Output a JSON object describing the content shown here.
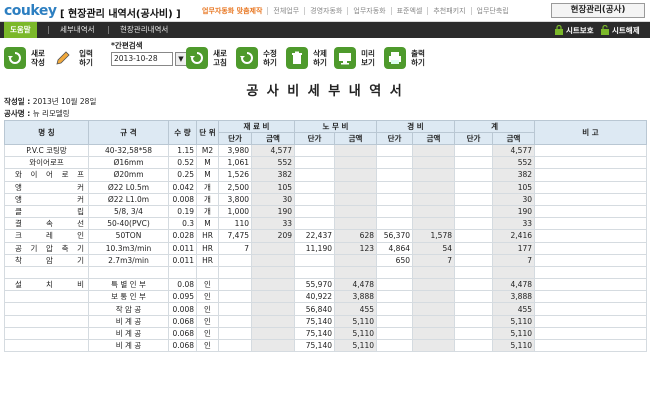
{
  "header": {
    "logo": "coukey",
    "title": "[ 현장관리 내역서(공사비) ]",
    "nav": [
      "업무자동화 맞춤제작",
      "전체업무",
      "경영자동화",
      "업무자동화",
      "표준엑셀",
      "추천패키지",
      "업무단축립"
    ],
    "user_button": "현장관리(공사)"
  },
  "menubar": {
    "tabs": [
      "도움말",
      "세부내역서",
      "현장관리내역서"
    ],
    "sheet_protect": "시트보호",
    "sheet_unprotect": "시트해제"
  },
  "toolbar": {
    "new_label": "새로\n작성",
    "input_label": "입력\n하기",
    "search_caption": "*간편검색",
    "search_date": "2013-10-28",
    "refresh_label": "새로\n고침",
    "edit_label": "수정\n하기",
    "delete_label": "삭제\n하기",
    "preview_label": "미리\n보기",
    "print_label": "출력\n하기"
  },
  "document": {
    "title": "공 사 비   세 부 내 역 서",
    "date_label": "작성일 :",
    "date_value": "2013년 10월 28일",
    "project_label": "공사명 :",
    "project_value": "뉴 리모델링"
  },
  "table": {
    "headers": {
      "name": "명 칭",
      "spec": "규 격",
      "qty": "수 량",
      "unit": "단 위",
      "material": "재 료 비",
      "labor": "노 무 비",
      "expense": "경 비",
      "total": "계",
      "note": "비 고",
      "unit_price": "단가",
      "amount": "금액"
    },
    "rows": [
      [
        "P.V.C 코팅망",
        "40-32,58*58",
        "1.15",
        "M2",
        "3,980",
        "4,577",
        "",
        "",
        "",
        "",
        "",
        "4,577",
        ""
      ],
      [
        "와이어로프",
        "Ø16mm",
        "0.52",
        "M",
        "1,061",
        "552",
        "",
        "",
        "",
        "",
        "",
        "552",
        ""
      ],
      [
        "와 이 어 로 프",
        "Ø20mm",
        "0.25",
        "M",
        "1,526",
        "382",
        "",
        "",
        "",
        "",
        "",
        "382",
        ""
      ],
      [
        "앵 커",
        "Ø22 L0.5m",
        "0.042",
        "개",
        "2,500",
        "105",
        "",
        "",
        "",
        "",
        "",
        "105",
        ""
      ],
      [
        "앵 커",
        "Ø22 L1.0m",
        "0.008",
        "개",
        "3,800",
        "30",
        "",
        "",
        "",
        "",
        "",
        "30",
        ""
      ],
      [
        "클 립",
        "5/8, 3/4",
        "0.19",
        "개",
        "1,000",
        "190",
        "",
        "",
        "",
        "",
        "",
        "190",
        ""
      ],
      [
        "결 속 선",
        "50-40(PVC)",
        "0.3",
        "M",
        "110",
        "33",
        "",
        "",
        "",
        "",
        "",
        "33",
        ""
      ],
      [
        "크 레 인",
        "50TON",
        "0.028",
        "HR",
        "7,475",
        "209",
        "22,437",
        "628",
        "56,370",
        "1,578",
        "",
        "2,416",
        ""
      ],
      [
        "공 기 압 축 기",
        "10.3m3/min",
        "0.011",
        "HR",
        "7",
        "",
        "11,190",
        "123",
        "4,864",
        "54",
        "",
        "177",
        ""
      ],
      [
        "착 암 기",
        "2.7m3/min",
        "0.011",
        "HR",
        "",
        "",
        "",
        "",
        "650",
        "7",
        "",
        "7",
        ""
      ],
      [
        "",
        "",
        "",
        "",
        "",
        "",
        "",
        "",
        "",
        "",
        "",
        "",
        ""
      ],
      [
        "설 치 비",
        "특 별 인 부",
        "0.08",
        "인",
        "",
        "",
        "55,970",
        "4,478",
        "",
        "",
        "",
        "4,478",
        ""
      ],
      [
        "",
        "보 통 인 부",
        "0.095",
        "인",
        "",
        "",
        "40,922",
        "3,888",
        "",
        "",
        "",
        "3,888",
        ""
      ],
      [
        "",
        "작 암 공",
        "0.008",
        "인",
        "",
        "",
        "56,840",
        "455",
        "",
        "",
        "",
        "455",
        ""
      ],
      [
        "",
        "비 계 공",
        "0.068",
        "인",
        "",
        "",
        "75,140",
        "5,110",
        "",
        "",
        "",
        "5,110",
        ""
      ],
      [
        "",
        "비 계 공",
        "0.068",
        "인",
        "",
        "",
        "75,140",
        "5,110",
        "",
        "",
        "",
        "5,110",
        ""
      ],
      [
        "",
        "비 계 공",
        "0.068",
        "인",
        "",
        "",
        "75,140",
        "5,110",
        "",
        "",
        "",
        "5,110",
        ""
      ]
    ]
  },
  "colors": {
    "logo": "#2d7fc1",
    "nav_highlight": "#e87722",
    "menubar_bg": "#2b2b2b",
    "active_tab": "#7bb82a",
    "header_cell": "#dde9f3"
  }
}
